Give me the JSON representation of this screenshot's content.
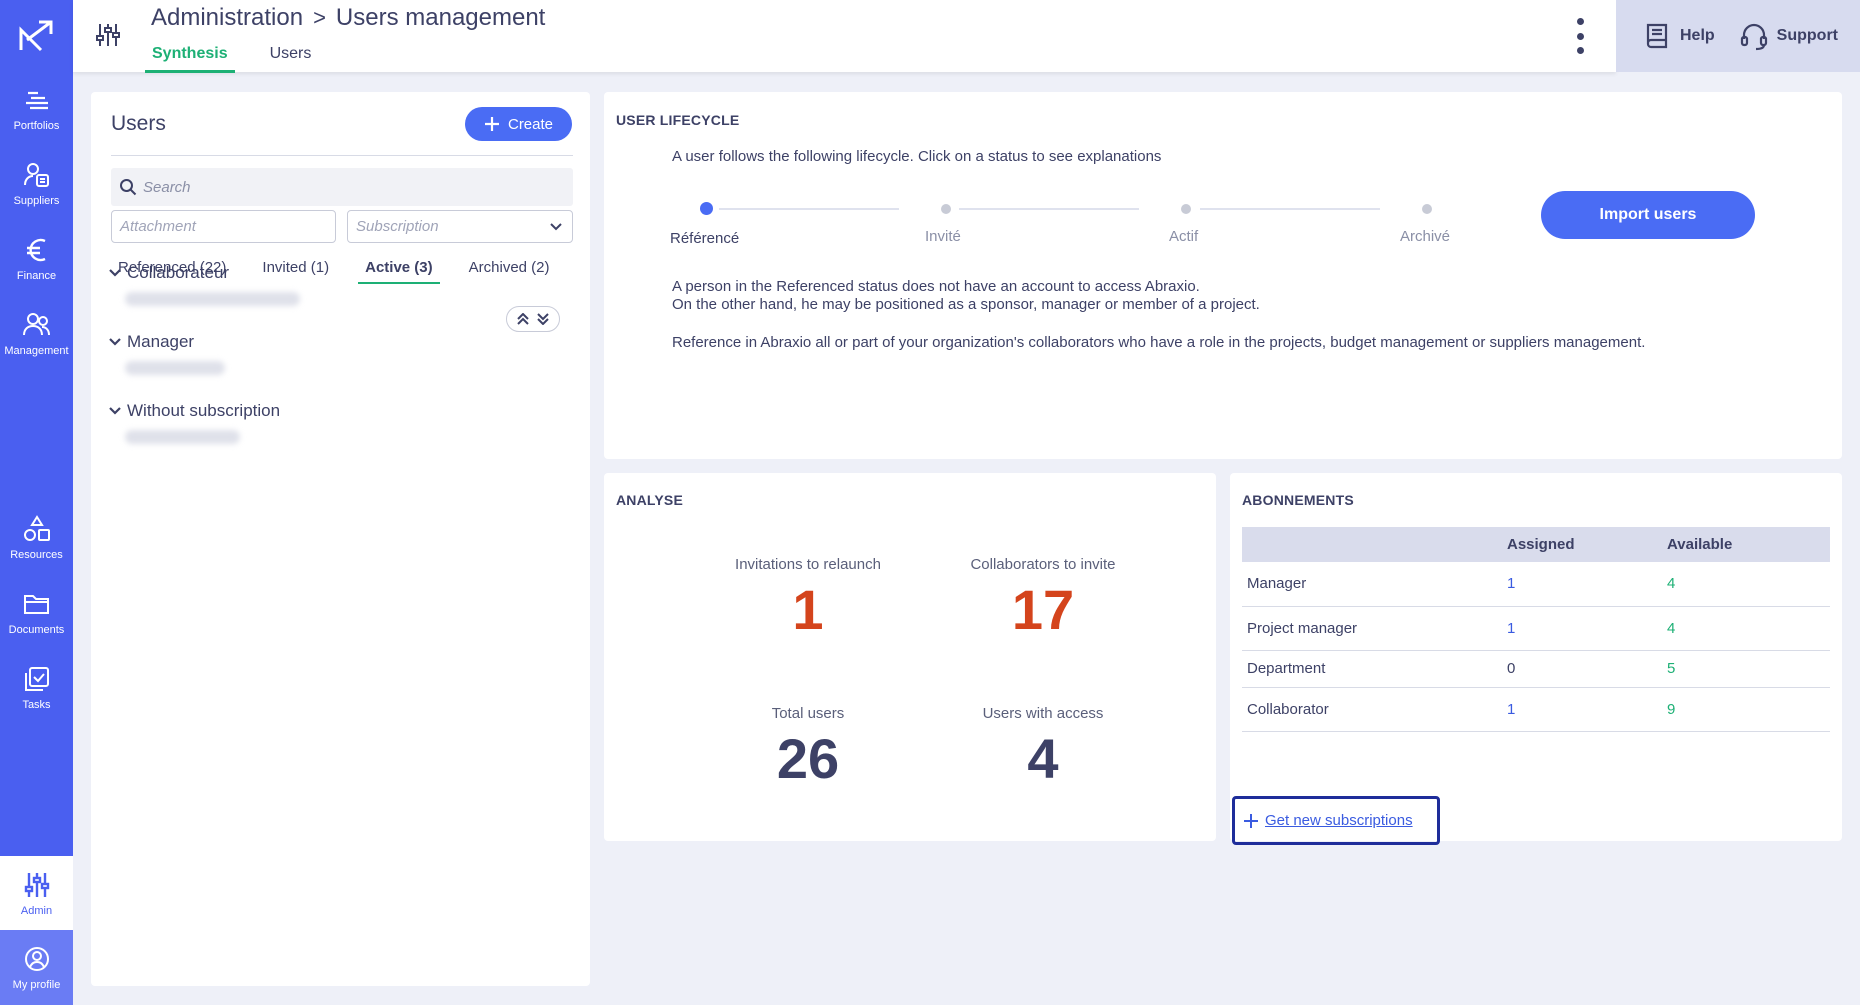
{
  "nav": {
    "items": [
      {
        "label": "Portfolios",
        "icon": "portfolios-icon"
      },
      {
        "label": "Suppliers",
        "icon": "suppliers-icon"
      },
      {
        "label": "Finance",
        "icon": "euro-icon"
      },
      {
        "label": "Management",
        "icon": "management-icon"
      },
      {
        "label": "Resources",
        "icon": "resources-icon"
      },
      {
        "label": "Documents",
        "icon": "folder-icon"
      },
      {
        "label": "Tasks",
        "icon": "tasks-icon"
      },
      {
        "label": "Admin",
        "icon": "admin-sliders-icon"
      },
      {
        "label": "My profile",
        "icon": "profile-icon"
      }
    ]
  },
  "header": {
    "breadcrumb_root": "Administration",
    "breadcrumb_sep": ">",
    "breadcrumb_page": "Users management",
    "tabs": [
      {
        "label": "Synthesis",
        "active": true
      },
      {
        "label": "Users",
        "active": false
      }
    ],
    "help_label": "Help",
    "support_label": "Support"
  },
  "users_panel": {
    "title": "Users",
    "create_label": "Create",
    "search_placeholder": "Search",
    "attachment_placeholder": "Attachment",
    "subscription_placeholder": "Subscription",
    "tabs": [
      {
        "label": "Referenced (22)",
        "active": false
      },
      {
        "label": "Invited (1)",
        "active": false
      },
      {
        "label": "Active (3)",
        "active": true
      },
      {
        "label": "Archived (2)",
        "active": false
      }
    ],
    "groups": [
      {
        "label": "Collaborateur"
      },
      {
        "label": "Manager"
      },
      {
        "label": "Without subscription"
      }
    ]
  },
  "lifecycle": {
    "title": "USER LIFECYCLE",
    "intro": "A user follows the following lifecycle. Click on a status to see explanations",
    "statuses": [
      {
        "label": "Référencé",
        "active": true
      },
      {
        "label": "Invité",
        "active": false
      },
      {
        "label": "Actif",
        "active": false
      },
      {
        "label": "Archivé",
        "active": false
      }
    ],
    "import_label": "Import users",
    "desc_line1": "A person in the Referenced status does not have an account to access Abraxio.",
    "desc_line2": "On the other hand, he may be positioned as a sponsor, manager or member of a project.",
    "desc_line3": "Reference in Abraxio all or part of your organization's collaborators who have a role in the projects, budget management or suppliers management."
  },
  "analyse": {
    "title": "ANALYSE",
    "metrics": [
      {
        "label": "Invitations to relaunch",
        "value": "1",
        "color": "#d4441c"
      },
      {
        "label": "Collaborators to invite",
        "value": "17",
        "color": "#d4441c"
      },
      {
        "label": "Total users",
        "value": "26",
        "color": "#3d4166"
      },
      {
        "label": "Users with access",
        "value": "4",
        "color": "#3d4166"
      }
    ]
  },
  "abonnements": {
    "title": "ABONNEMENTS",
    "columns": [
      "",
      "Assigned",
      "Available"
    ],
    "rows": [
      {
        "name": "Manager",
        "assigned": "1",
        "available": "4"
      },
      {
        "name": "Project manager",
        "assigned": "1",
        "available": "4"
      },
      {
        "name": "Department",
        "assigned": "0",
        "available": "5"
      },
      {
        "name": "Collaborator",
        "assigned": "1",
        "available": "9"
      }
    ],
    "get_new_label": "Get new subscriptions"
  },
  "colors": {
    "rail": "#4a5ff0",
    "accent_green": "#1db075",
    "primary_button": "#4a6cf4",
    "metric_orange": "#d4441c",
    "link_blue": "#3a5be0"
  }
}
